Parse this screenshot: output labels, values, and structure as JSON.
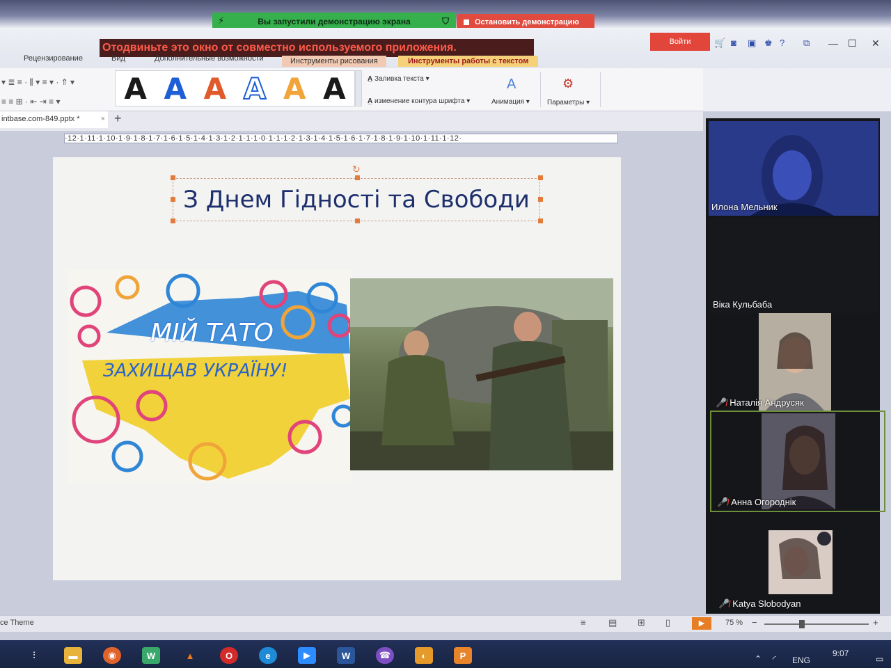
{
  "share": {
    "banner": "Вы запустили демонстрацию экрана",
    "stop": "Остановить демонстрацию",
    "warning": "Отодвиньте это окно от совместно используемого приложения."
  },
  "tabs": {
    "review": "Рецензирование",
    "view": "Вид",
    "extras": "Дополнительные возможности",
    "drawing": "Инструменты рисования",
    "text_tools": "Инструменты работы с текстом"
  },
  "top": {
    "login": "Войти"
  },
  "ribbon": {
    "style_letter": "A",
    "text_fill": "Заливка текста",
    "text_outline": "изменение контура шрифта",
    "animation": "Анимация",
    "params": "Параметры",
    "colors": {
      "black": "#1a1a1a",
      "blue": "#1f5fd6",
      "orange": "#e05a2b",
      "gold": "#f0a43a"
    }
  },
  "file": {
    "name": "intbase.com-849.pptx *",
    "close": "×",
    "add": "+"
  },
  "ruler": {
    "text": "·12·1·11·1·10·1·9·1·8·1·7·1·6·1·5·1·4·1·3·1·2·1·1·1·0·1·1·1·2·1·3·1·4·1·5·1·6·1·7·1·8·1·9·1·10·1·11·1·12·"
  },
  "slide": {
    "title": "З Днем Гідності та Свободи",
    "poster_line1": "МІЙ ТАТО",
    "poster_line2": "ЗАХИЩАВ УКРАЇНУ!",
    "colors": {
      "blue": "#2f86d6",
      "yellow": "#f1d23a",
      "pink": "#e0447a",
      "title": "#1e2f6e"
    }
  },
  "participants": [
    {
      "name": "Илона Мельник",
      "muted": false
    },
    {
      "name": "Віка Кульбаба",
      "muted": false
    },
    {
      "name": "Наталія Андрусяк",
      "muted": true
    },
    {
      "name": "Анна Огороднік",
      "muted": true
    },
    {
      "name": "Katya Slobodyan",
      "muted": true
    }
  ],
  "status": {
    "theme": "ce Theme",
    "zoom": "75 %"
  },
  "taskbar": {
    "lang": "ENG",
    "time": "9:07"
  }
}
